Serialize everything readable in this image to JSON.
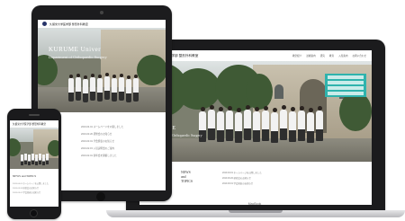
{
  "site": {
    "name": "久留米大学医学部 整形外科教室",
    "hero_title": "KURUME",
    "hero_subtitle": "Department of Orthopaedic Surgery",
    "nav": [
      "教室紹介",
      "診療案内",
      "研究",
      "教育",
      "入局案内",
      "お問い合わせ"
    ]
  },
  "tablet": {
    "hero_title": "KURUME Univer",
    "hero_subtitle": "Department of Orthopaedic Surgery"
  },
  "news": {
    "heading": "NEWS and TOPICS",
    "heading_lines": [
      "NEWS",
      "and",
      "TOPICS"
    ],
    "items": [
      "2019.04.01 ホームページを公開しました",
      "2019.03.20 研修会のお知らせ",
      "2019.03.01 学会発表のお知らせ",
      "2019.02.15 入局説明会のご案内",
      "2019.02.01 新年会を開催しました"
    ]
  },
  "laptop": {
    "brand": "MacBook"
  },
  "colors": {
    "accent_teal": "#2fb3ad",
    "logo_navy": "#28356b",
    "device_black": "#1b1b1d"
  }
}
